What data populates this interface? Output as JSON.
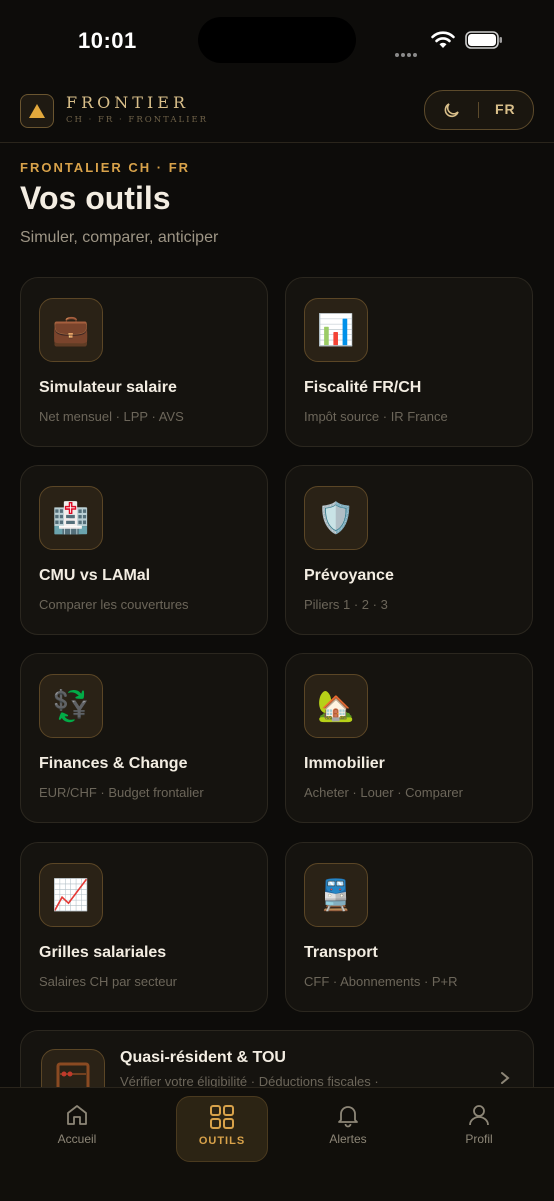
{
  "status_bar": {
    "time": "10:01"
  },
  "header": {
    "brand": "FRONTIER",
    "brand_sub": "CH · FR · FRONTALIER",
    "language": "FR"
  },
  "intro": {
    "eyebrow": "FRONTALIER CH · FR",
    "title": "Vos outils",
    "subtitle": "Simuler, comparer, anticiper"
  },
  "tools": [
    {
      "title": "Simulateur salaire",
      "subtitle": "Net mensuel · LPP · AVS",
      "icon": "briefcase-icon",
      "glyph": "💼"
    },
    {
      "title": "Fiscalité FR/CH",
      "subtitle": "Impôt source · IR France",
      "icon": "bar-chart-icon",
      "glyph": "📊"
    },
    {
      "title": "CMU vs LAMal",
      "subtitle": "Comparer les couvertures",
      "icon": "hospital-icon",
      "glyph": "🏥"
    },
    {
      "title": "Prévoyance",
      "subtitle": "Piliers 1 · 2 · 3",
      "icon": "shield-icon",
      "glyph": "🛡️"
    },
    {
      "title": "Finances & Change",
      "subtitle": "EUR/CHF · Budget frontalier",
      "icon": "currency-exchange-icon",
      "glyph": "💱"
    },
    {
      "title": "Immobilier",
      "subtitle": "Acheter · Louer · Comparer",
      "icon": "house-icon",
      "glyph": "🏡"
    },
    {
      "title": "Grilles salariales",
      "subtitle": "Salaires CH par secteur",
      "icon": "chart-increasing-icon",
      "glyph": "📈"
    },
    {
      "title": "Transport",
      "subtitle": "CFF · Abonnements · P+R",
      "icon": "train-icon",
      "glyph": "🚆"
    }
  ],
  "wide_tool": {
    "title": "Quasi-résident & TOU",
    "subtitle": "Vérifier votre éligibilité · Déductions fiscales ·",
    "icon": "abacus-icon"
  },
  "tabbar": {
    "items": [
      {
        "label": "Accueil",
        "icon": "home-icon"
      },
      {
        "label": "OUTILS",
        "icon": "grid-icon",
        "active": true
      },
      {
        "label": "Alertes",
        "icon": "bell-icon"
      },
      {
        "label": "Profil",
        "icon": "user-icon"
      }
    ]
  },
  "colors": {
    "accent": "#d8a24a",
    "background": "#0d0c0a",
    "card": "#15130f"
  }
}
